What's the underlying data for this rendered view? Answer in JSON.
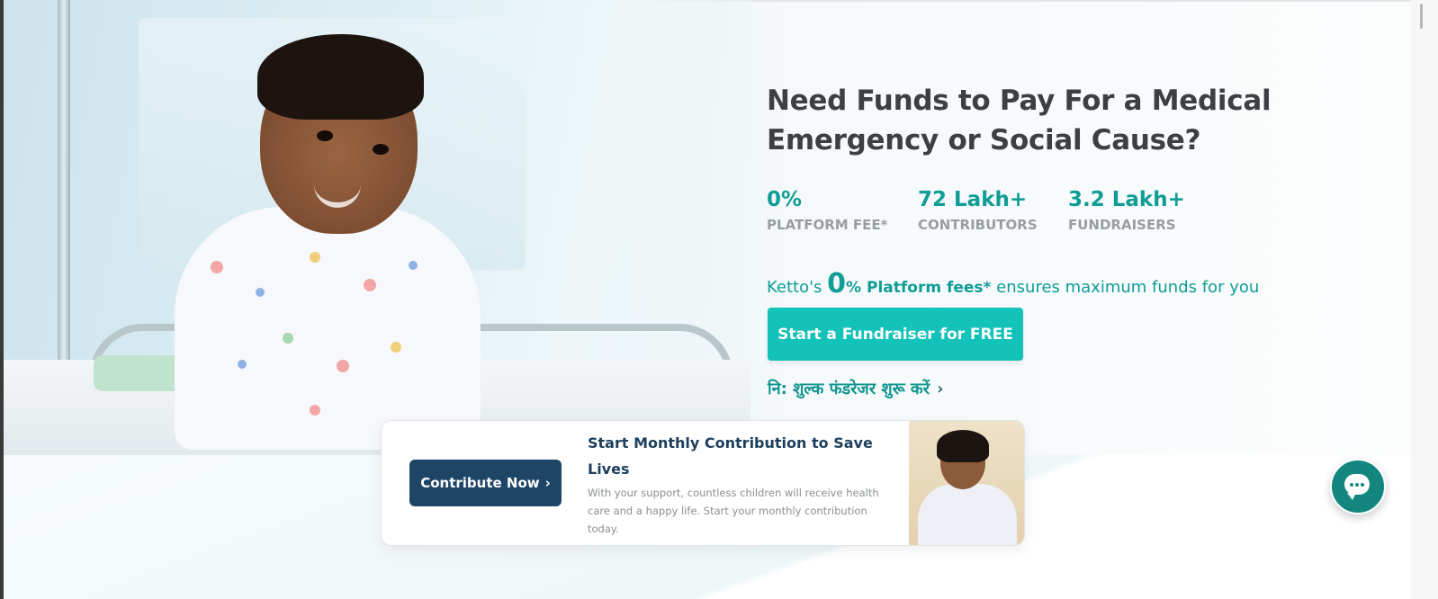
{
  "hero": {
    "headline": "Need Funds to Pay For a Medical Emergency or Social Cause?",
    "stats": [
      {
        "value": "0%",
        "label": "PLATFORM FEE*"
      },
      {
        "value": "72 Lakh+",
        "label": "CONTRIBUTORS"
      },
      {
        "value": "3.2 Lakh+",
        "label": "FUNDRAISERS"
      }
    ],
    "tagline": {
      "prefix": "Ketto's ",
      "big": "0",
      "bold": "% Platform fees*",
      "suffix": " ensures maximum funds for you"
    },
    "cta_label": "Start a Fundraiser for FREE",
    "hindi_link": "नि: शुल्क फंडरेजर शुरू करें",
    "hindi_chevron": "›"
  },
  "monthly_card": {
    "button_label": "Contribute Now",
    "button_chevron": "›",
    "title": "Start Monthly Contribution to Save Lives",
    "description": "With your support, countless children will receive health care and a happy life. Start your monthly contribution today."
  },
  "colors": {
    "accent": "#13c2b8",
    "teal_text": "#0f9d95",
    "navy_button": "#1f4566",
    "chat_button": "#13877f"
  },
  "icons": {
    "chat": "chat-bubble-icon",
    "chevron": "chevron-right-icon"
  }
}
